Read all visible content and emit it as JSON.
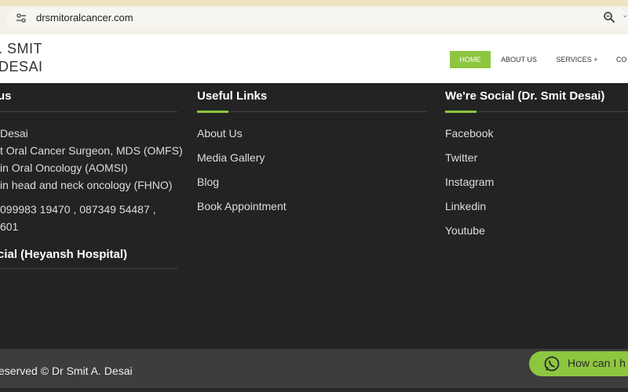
{
  "browser": {
    "url": "drsmitoralcancer.com",
    "more": "⌄"
  },
  "header": {
    "logo_line1": ". SMIT",
    "logo_line2": "DESAI",
    "nav": {
      "home": "HOME",
      "about": "ABOUT US",
      "services": "SERVICES +",
      "contact": "CO"
    }
  },
  "footer": {
    "about": {
      "heading": "us",
      "lines": [
        "Desai",
        "t Oral Cancer Surgeon, MDS (OMFS)",
        " in Oral Oncology (AOMSI)",
        " in head and neck oncology (FHNO)",
        "099983 19470 , 087349 54487  ,",
        "601"
      ]
    },
    "links": {
      "heading": "Useful Links",
      "items": [
        "About Us",
        "Media Gallery",
        "Blog",
        "Book Appointment"
      ]
    },
    "social": {
      "heading": "We're Social (Dr. Smit Desai)",
      "items": [
        "Facebook",
        "Twitter",
        "Instagram",
        "Linkedin",
        "Youtube"
      ]
    },
    "hospital": {
      "heading": "cial (Heyansh Hospital)"
    },
    "copyright": "eserved © Dr Smit A. Desai",
    "whatsapp": "How can I h"
  },
  "colors": {
    "accent": "#8dc63f",
    "footer_bg": "#232323",
    "bottom_bar": "#3d3d3d"
  }
}
